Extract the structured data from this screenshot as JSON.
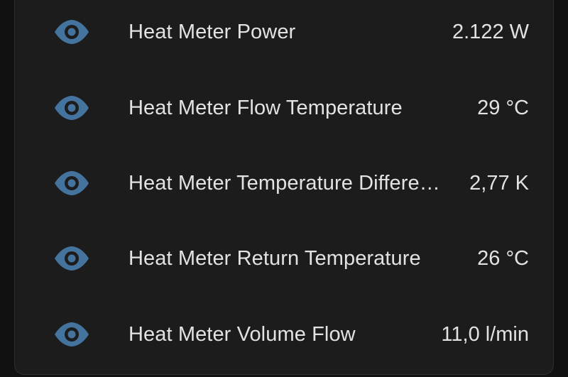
{
  "colors": {
    "icon": "#44739e",
    "text": "#e2e2e2",
    "card_background": "#1c1c1c"
  },
  "entities": [
    {
      "icon": "eye-icon",
      "name": "Heat Meter Power",
      "value": "2.122 W"
    },
    {
      "icon": "eye-icon",
      "name": "Heat Meter Flow Temperature",
      "value": "29 °C"
    },
    {
      "icon": "eye-icon",
      "name": "Heat Meter Temperature Differe…",
      "value": "2,77 K"
    },
    {
      "icon": "eye-icon",
      "name": "Heat Meter Return Temperature",
      "value": "26 °C"
    },
    {
      "icon": "eye-icon",
      "name": "Heat Meter Volume Flow",
      "value": "11,0 l/min"
    }
  ]
}
